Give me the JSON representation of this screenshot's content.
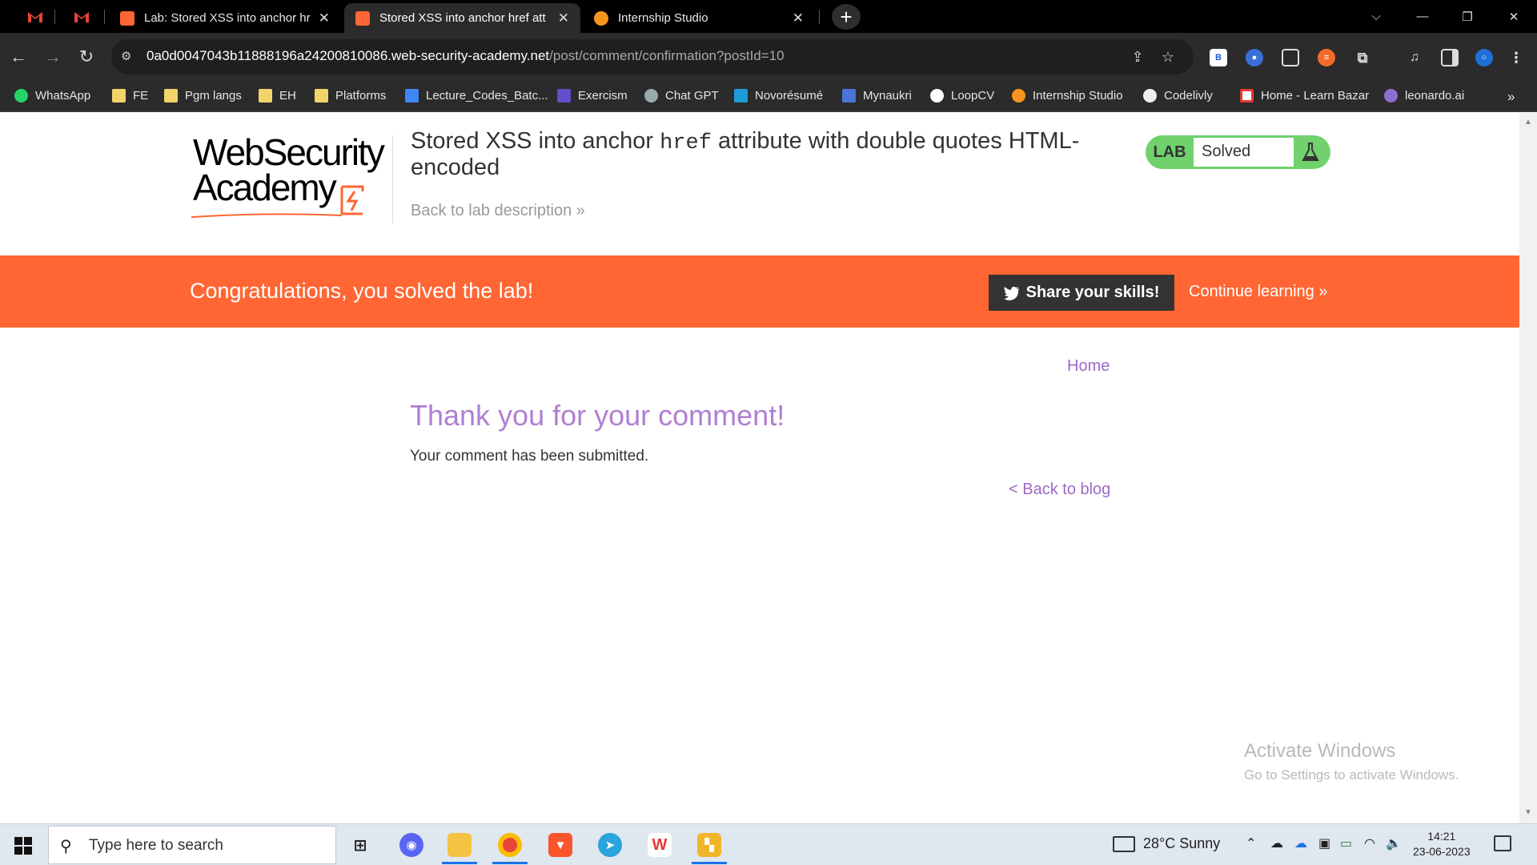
{
  "browser": {
    "tabs": [
      {
        "title": "Lab: Stored XSS into anchor hre",
        "favicon_color": "#ff6633"
      },
      {
        "title": "Stored XSS into anchor href att",
        "favicon_color": "#ff6633"
      },
      {
        "title": "Internship Studio",
        "favicon_color": "#f7941d"
      }
    ],
    "url_host": "0a0d0047043b11888196a24200810086.web-security-academy.net",
    "url_path": "/post/comment/confirmation?postId=10",
    "bookmarks": [
      {
        "label": "WhatsApp",
        "icon": "whatsapp-icon"
      },
      {
        "label": "FE",
        "icon": "folder-icon"
      },
      {
        "label": "Pgm langs",
        "icon": "folder-icon"
      },
      {
        "label": "EH",
        "icon": "folder-icon"
      },
      {
        "label": "Platforms",
        "icon": "folder-icon"
      },
      {
        "label": "Lecture_Codes_Batc...",
        "icon": "docs-icon"
      },
      {
        "label": "Exercism",
        "icon": "exercism-icon"
      },
      {
        "label": "Chat GPT",
        "icon": "openai-icon"
      },
      {
        "label": "Novorésumé",
        "icon": "novoresume-icon"
      },
      {
        "label": "Mynaukri",
        "icon": "naukri-icon"
      },
      {
        "label": "LoopCV",
        "icon": "loopcv-icon"
      },
      {
        "label": "Internship Studio",
        "icon": "internship-icon"
      },
      {
        "label": "Codelivly",
        "icon": "codelivly-icon"
      },
      {
        "label": "Home - Learn Bazar",
        "icon": "learnbazar-icon"
      },
      {
        "label": "leonardo.ai",
        "icon": "leonardo-icon"
      }
    ],
    "more_bookmarks": "»"
  },
  "header": {
    "logo_line1": "WebSecurity",
    "logo_line2": "Academy",
    "lab_title_part1": "Stored XSS into anchor ",
    "lab_title_code": "href",
    "lab_title_part2": " attribute with double quotes HTML-encoded",
    "back_to_description": "Back to lab description",
    "lab_badge": "LAB",
    "lab_status": "Solved"
  },
  "banner": {
    "message": "Congratulations, you solved the lab!",
    "share_button": "Share your skills!",
    "continue_link": "Continue learning"
  },
  "content": {
    "home_link": "Home",
    "heading": "Thank you for your comment!",
    "body": "Your comment has been submitted.",
    "back_link": "< Back to blog"
  },
  "watermark": {
    "line1": "Activate Windows",
    "line2": "Go to Settings to activate Windows."
  },
  "taskbar": {
    "search_placeholder": "Type here to search",
    "weather": "28°C  Sunny",
    "time": "14:21",
    "date": "23-06-2023"
  },
  "colors": {
    "brand_orange": "#ff6633",
    "solved_green": "#70d16d",
    "link_purple": "#9e69c6"
  }
}
